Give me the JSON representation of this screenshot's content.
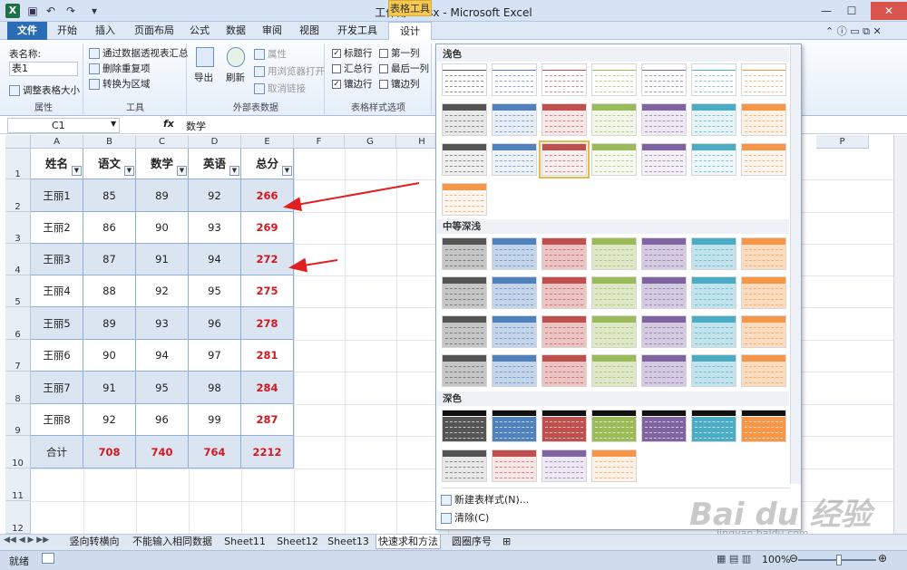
{
  "window": {
    "title": "工作簿1.xlsx - Microsoft Excel",
    "context_tab": "表格工具"
  },
  "tabs": [
    "文件",
    "开始",
    "插入",
    "页面布局",
    "公式",
    "数据",
    "审阅",
    "视图",
    "开发工具",
    "设计"
  ],
  "ribbon": {
    "props": {
      "table_name_label": "表名称:",
      "table_name": "表1",
      "resize": "调整表格大小",
      "group": "属性"
    },
    "tools": {
      "pivot": "通过数据透视表汇总",
      "remove_dup": "删除重复项",
      "convert": "转换为区域",
      "group": "工具"
    },
    "external": {
      "export": "导出",
      "refresh": "刷新",
      "properties": "属性",
      "open_browser": "用浏览器打开",
      "unlink": "取消链接",
      "group": "外部表数据"
    },
    "style_options": {
      "header_row": "标题行",
      "total_row": "汇总行",
      "banded_rows": "镶边行",
      "first_col": "第一列",
      "last_col": "最后一列",
      "banded_cols": "镶边列",
      "group": "表格样式选项"
    }
  },
  "formula_bar": {
    "name_box": "C1",
    "fx": "fx",
    "value": "数学"
  },
  "columns": [
    "A",
    "B",
    "C",
    "D",
    "E",
    "F",
    "G",
    "H",
    "P"
  ],
  "rows": [
    "1",
    "2",
    "3",
    "4",
    "5",
    "6",
    "7",
    "8",
    "9",
    "10",
    "11",
    "12"
  ],
  "table": {
    "headers": [
      "姓名",
      "语文",
      "数学",
      "英语",
      "总分"
    ],
    "data": [
      [
        "王丽1",
        "85",
        "89",
        "92",
        "266"
      ],
      [
        "王丽2",
        "86",
        "90",
        "93",
        "269"
      ],
      [
        "王丽3",
        "87",
        "91",
        "94",
        "272"
      ],
      [
        "王丽4",
        "88",
        "92",
        "95",
        "275"
      ],
      [
        "王丽5",
        "89",
        "93",
        "96",
        "278"
      ],
      [
        "王丽6",
        "90",
        "94",
        "97",
        "281"
      ],
      [
        "王丽7",
        "91",
        "95",
        "98",
        "284"
      ],
      [
        "王丽8",
        "92",
        "96",
        "99",
        "287"
      ]
    ],
    "total": [
      "合计",
      "708",
      "740",
      "764",
      "2212"
    ]
  },
  "gallery": {
    "light": "浅色",
    "medium": "中等深浅",
    "dark": "深色",
    "new_style": "新建表样式(N)...",
    "clear": "清除(C)",
    "colors": [
      "#555555",
      "#4f81bd",
      "#c0504d",
      "#9bbb59",
      "#8064a2",
      "#4bacc6",
      "#f79646"
    ]
  },
  "sheets": [
    "竖向转横向",
    "不能输入相同数据",
    "Sheet11",
    "Sheet12",
    "Sheet13",
    "快速求和方法",
    "圆圈序号"
  ],
  "status": {
    "ready": "就绪",
    "zoom": "100%"
  },
  "watermark": {
    "text": "Bai du 经验",
    "url": "jingyan.baidu.com"
  }
}
